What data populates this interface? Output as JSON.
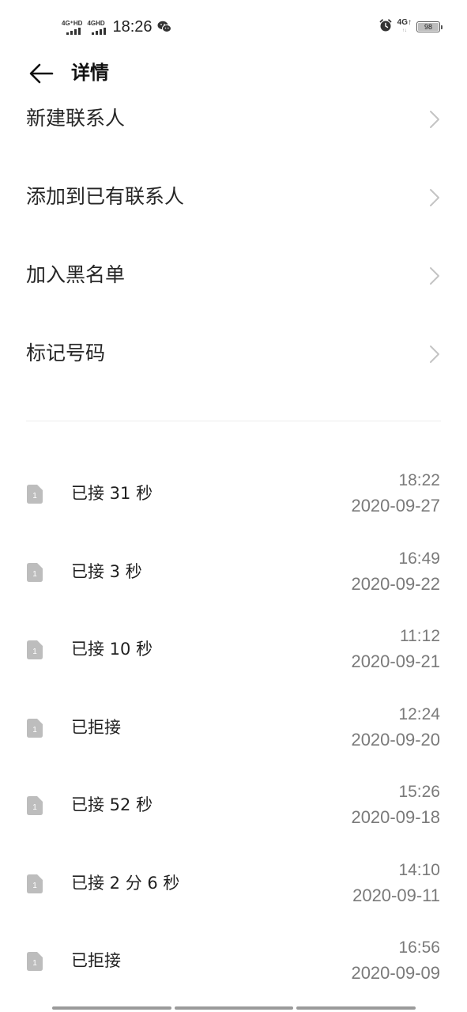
{
  "status_bar": {
    "signal_1_label": "4G⁺HD",
    "signal_2_label": "4GHD",
    "time": "18:26",
    "network": "4G↑",
    "network_sub": "↑↓",
    "battery": "98",
    "icons": [
      "signal-icon",
      "signal-icon",
      "wechat-icon",
      "alarm-icon",
      "battery-icon"
    ]
  },
  "header": {
    "title": "详情",
    "back_icon": "arrow-left-icon"
  },
  "actions": [
    {
      "label": "新建联系人",
      "icon": "chevron-right-icon"
    },
    {
      "label": "添加到已有联系人",
      "icon": "chevron-right-icon"
    },
    {
      "label": "加入黑名单",
      "icon": "chevron-right-icon"
    },
    {
      "label": "标记号码",
      "icon": "chevron-right-icon"
    }
  ],
  "call_log": [
    {
      "sim": "1",
      "type": "已接 31 秒",
      "time": "18:22",
      "date": "2020-09-27"
    },
    {
      "sim": "1",
      "type": "已接 3 秒",
      "time": "16:49",
      "date": "2020-09-22"
    },
    {
      "sim": "1",
      "type": "已接 10 秒",
      "time": "11:12",
      "date": "2020-09-21"
    },
    {
      "sim": "1",
      "type": "已拒接",
      "time": "12:24",
      "date": "2020-09-20"
    },
    {
      "sim": "1",
      "type": "已接 52 秒",
      "time": "15:26",
      "date": "2020-09-18"
    },
    {
      "sim": "1",
      "type": "已接 2 分 6 秒",
      "time": "14:10",
      "date": "2020-09-11"
    },
    {
      "sim": "1",
      "type": "已拒接",
      "time": "16:56",
      "date": "2020-09-09"
    }
  ],
  "colors": {
    "background": "#ffffff",
    "text_primary": "#1f1f1f",
    "text_secondary": "#7a7a7a",
    "sim_icon": "#bdbdbd",
    "chevron": "#c4c4c4"
  }
}
